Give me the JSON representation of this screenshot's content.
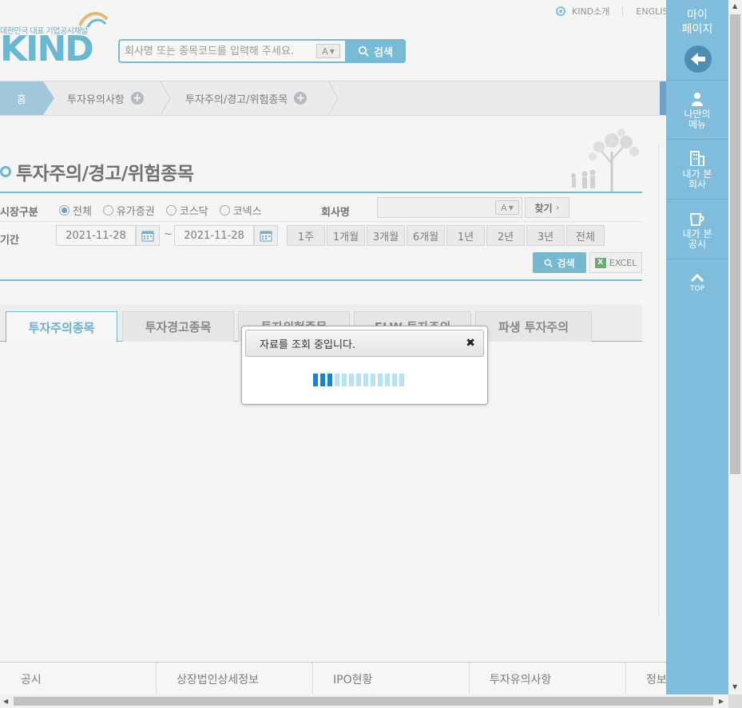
{
  "header": {
    "logo_tagline": "대한민국 대표 기업공시채널",
    "logo_text": "KIND",
    "top_links": [
      "KIND소개",
      "ENGLISH"
    ],
    "search_placeholder": "회사명 또는 종목코드를 입력해 주세요.",
    "autocomplete_label": "A",
    "search_button": "검색"
  },
  "breadcrumb": {
    "home": "홈",
    "level1": "투자유의사항",
    "level2": "투자주의/경고/위험종목"
  },
  "page": {
    "title": "투자주의/경고/위험종목"
  },
  "filters": {
    "market_label": "시장구분",
    "market_options": [
      "전체",
      "유가증권",
      "코스닥",
      "코넥스"
    ],
    "market_selected": "전체",
    "company_label": "회사명",
    "company_value": "",
    "find_button": "찾기",
    "period_label": "기간",
    "date_from": "2021-11-28",
    "date_sep": "~",
    "date_to": "2021-11-28",
    "period_buttons": [
      "1주",
      "1개월",
      "3개월",
      "6개월",
      "1년",
      "2년",
      "3년",
      "전체"
    ],
    "search_button": "검색",
    "excel_button": "EXCEL"
  },
  "tabs": [
    "투자주의종목",
    "투자경고종목",
    "투자위험종목",
    "ELW 투자주의",
    "파생 투자주의"
  ],
  "active_tab": "투자주의종목",
  "dialog": {
    "message": "자료를 조회 중입니다.",
    "close": "✖",
    "progress_segments_total": 13,
    "progress_segments_filled": 3
  },
  "footer": [
    "공시",
    "상장법인상세정보",
    "IPO현황",
    "투자유의사항",
    "정보"
  ],
  "sidebar": {
    "mypage": "마이\n페이지",
    "items": [
      {
        "label": "나만의\n메뉴",
        "icon": "person-icon"
      },
      {
        "label": "내가 본\n회사",
        "icon": "building-icon"
      },
      {
        "label": "내가 본\n공시",
        "icon": "cup-icon"
      }
    ],
    "top": "TOP"
  },
  "colors": {
    "accent": "#3da7cf",
    "sidebar": "#80bcdb",
    "progress_on": "#1583d6",
    "progress_off": "#b9e1f6"
  }
}
